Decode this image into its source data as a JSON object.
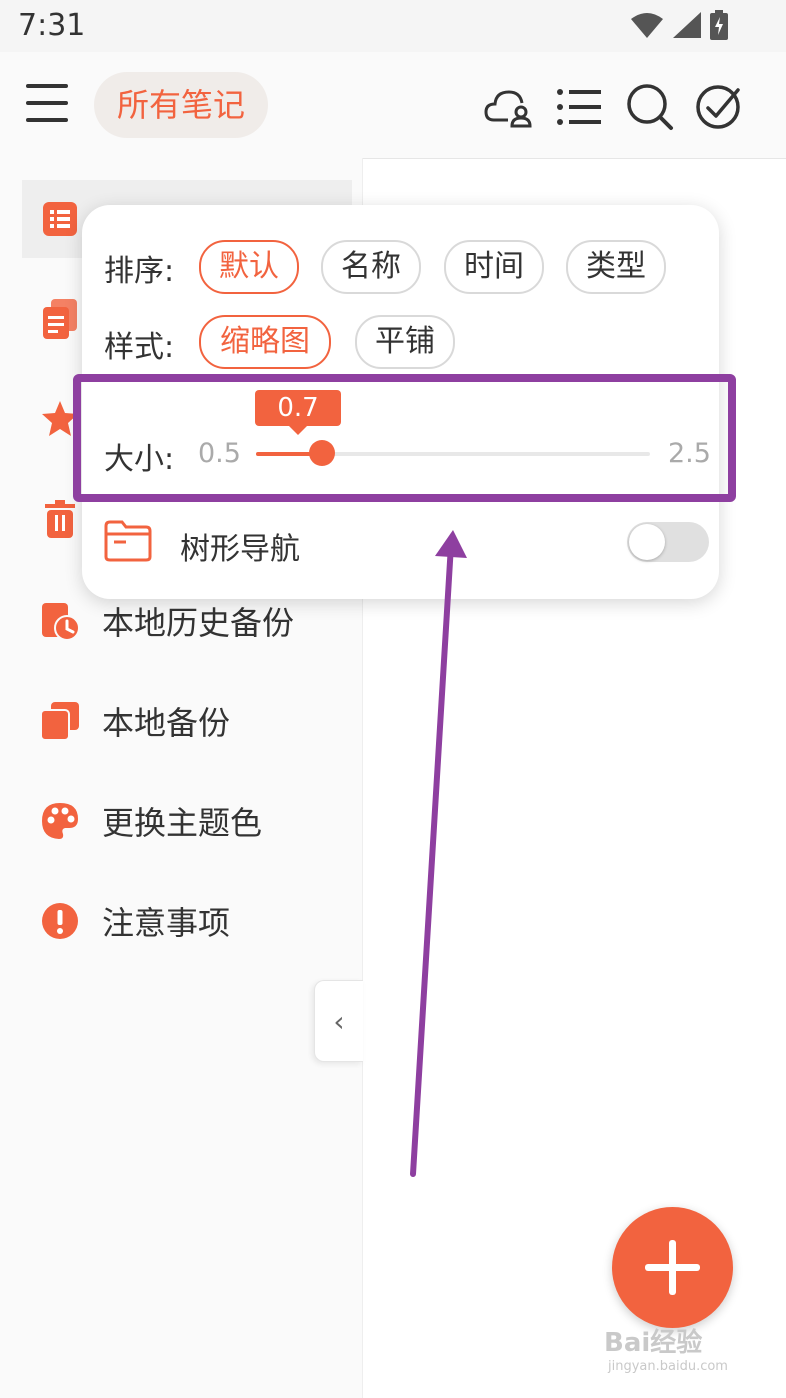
{
  "status_bar": {
    "time": "7:31",
    "icons": [
      "wifi-icon",
      "signal-icon",
      "battery-charging-icon"
    ]
  },
  "toolbar": {
    "title": "所有笔记",
    "icons": [
      "menu-icon",
      "cloud-user-icon",
      "list-icon",
      "search-icon",
      "check-circle-icon"
    ]
  },
  "sidebar": {
    "items": [
      {
        "label": "",
        "icon": "notes-list-icon"
      },
      {
        "label": "",
        "icon": "notes-stack-icon"
      },
      {
        "label": "",
        "icon": "star-icon"
      },
      {
        "label": "",
        "icon": "trash-icon"
      },
      {
        "label": "本地历史备份",
        "icon": "history-backup-icon"
      },
      {
        "label": "本地备份",
        "icon": "backup-icon"
      },
      {
        "label": "更换主题色",
        "icon": "palette-icon"
      },
      {
        "label": "注意事项",
        "icon": "warning-icon"
      }
    ],
    "collapse_glyph": "‹"
  },
  "popup": {
    "sort": {
      "label": "排序:",
      "options": [
        "默认",
        "名称",
        "时间",
        "类型"
      ],
      "selected": "默认"
    },
    "style": {
      "label": "样式:",
      "options": [
        "缩略图",
        "平铺"
      ],
      "selected": "缩略图"
    },
    "size": {
      "label": "大小:",
      "min": "0.5",
      "max": "2.5",
      "value": "0.7"
    },
    "tree_nav": {
      "label": "树形导航",
      "enabled": false
    }
  },
  "fab": {
    "icon": "plus-icon"
  },
  "watermark": {
    "brand": "Bai经验",
    "url": "jingyan.baidu.com"
  },
  "colors": {
    "accent": "#f2633f",
    "annotation": "#8e3fa0"
  }
}
